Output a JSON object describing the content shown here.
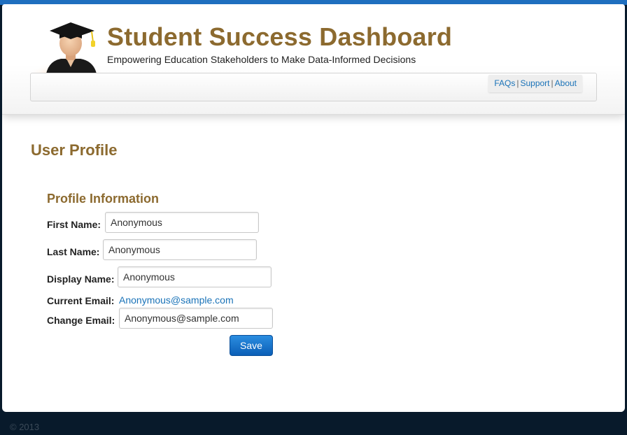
{
  "header": {
    "title": "Student Success Dashboard",
    "subtitle": "Empowering Education Stakeholders to Make Data-Informed Decisions",
    "logo_icon": "graduate-avatar-icon"
  },
  "nav": {
    "faqs": "FAQs",
    "support": "Support",
    "about": "About",
    "separator": "|"
  },
  "main": {
    "page_title": "User Profile",
    "section_title": "Profile Information",
    "first_name_label": "First Name:",
    "first_name_value": "Anonymous",
    "last_name_label": "Last Name:",
    "last_name_value": "Anonymous",
    "display_name_label": "Display Name:",
    "display_name_value": "Anonymous",
    "current_email_label": "Current Email:",
    "current_email_value": "Anonymous@sample.com",
    "change_email_label": "Change Email:",
    "change_email_value": "Anonymous@sample.com",
    "save_label": "Save"
  },
  "footer": {
    "copyright": "© 2013"
  },
  "colors": {
    "brand_gold": "#8c6a2f",
    "link_blue": "#1a73b8",
    "button_blue": "#0b5fb7",
    "footer_bg": "#081a2b"
  }
}
